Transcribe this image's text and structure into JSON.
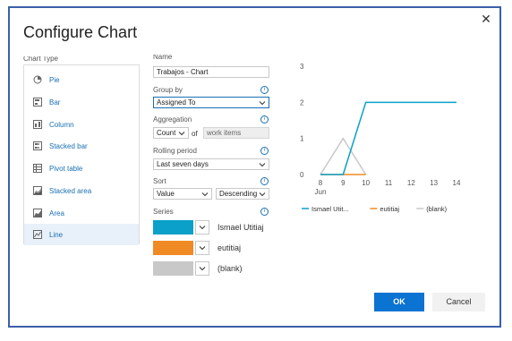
{
  "dialog": {
    "title": "Configure Chart",
    "close_glyph": "✕"
  },
  "chart_type": {
    "label": "Chart Type",
    "items": [
      {
        "label": "Pie",
        "icon": "pie-icon"
      },
      {
        "label": "Bar",
        "icon": "bar-icon"
      },
      {
        "label": "Column",
        "icon": "column-icon"
      },
      {
        "label": "Stacked bar",
        "icon": "stacked-bar-icon"
      },
      {
        "label": "Pivot table",
        "icon": "pivot-table-icon"
      },
      {
        "label": "Stacked area",
        "icon": "stacked-area-icon"
      },
      {
        "label": "Area",
        "icon": "area-icon"
      },
      {
        "label": "Line",
        "icon": "line-icon",
        "selected": true
      }
    ]
  },
  "config": {
    "name_label": "Name",
    "name_value": "Trabajos - Chart",
    "group_by_label": "Group by",
    "group_by_value": "Assigned To",
    "aggregation_label": "Aggregation",
    "aggregation_value": "Count",
    "of_text": "of",
    "aggregation_field": "work items",
    "rolling_period_label": "Rolling period",
    "rolling_period_value": "Last seven days",
    "sort_label": "Sort",
    "sort_by_value": "Value",
    "sort_order_value": "Descending",
    "series_label": "Series",
    "info_glyph": "i"
  },
  "series": [
    {
      "name": "Ismael Utitiaj",
      "color": "#0aa0c9"
    },
    {
      "name": "eutitiaj",
      "color": "#f08a24"
    },
    {
      "name": "(blank)",
      "color": "#c8c8c8"
    }
  ],
  "chart_data": {
    "type": "line",
    "x": [
      8,
      9,
      10,
      11,
      12,
      13,
      14
    ],
    "x_tick_labels": [
      "8",
      "9",
      "10",
      "11",
      "12",
      "13",
      "14"
    ],
    "x_sub_label": "Jun",
    "ylim": [
      0,
      3
    ],
    "y_ticks": [
      0,
      1,
      2,
      3
    ],
    "series": [
      {
        "name": "Ismael Utit...",
        "color": "#0aa0c9",
        "values": [
          0,
          0,
          2,
          2,
          2,
          2,
          2
        ]
      },
      {
        "name": "eutitiaj",
        "color": "#f08a24",
        "values": [
          0,
          0,
          0,
          null,
          null,
          null,
          null
        ]
      },
      {
        "name": "(blank)",
        "color": "#c8c8c8",
        "values": [
          0,
          1,
          0,
          null,
          null,
          null,
          null
        ]
      }
    ],
    "legend_position": "bottom"
  },
  "buttons": {
    "ok": "OK",
    "cancel": "Cancel"
  }
}
